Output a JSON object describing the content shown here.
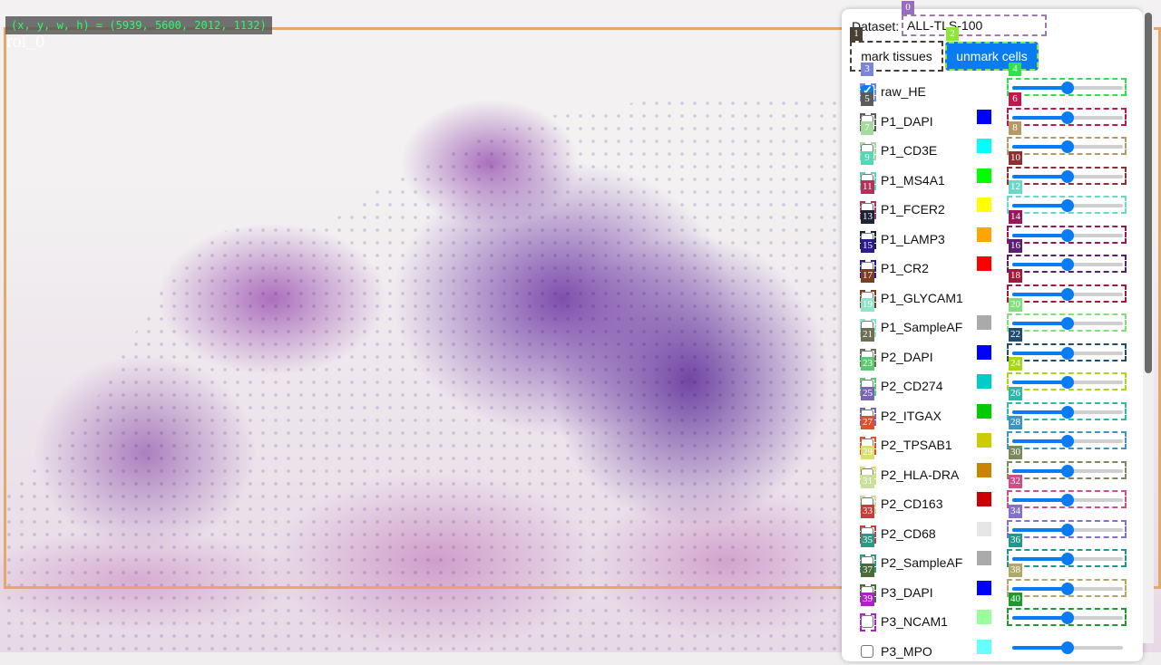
{
  "viewer": {
    "coords_text": "(x, y, w, h) = (5939, 5600, 2012, 1132)",
    "roi_label": "roi_0",
    "roi_color": "#e3a86a"
  },
  "panel": {
    "dataset_label": "Dataset:",
    "dataset_value": "ALL-TLS-100",
    "mark_tissues_label": "mark tissues",
    "unmark_cells_label": "unmark cells",
    "tags": {
      "dataset": "0",
      "mark": "1",
      "unmark": "2"
    }
  },
  "channels": [
    {
      "name": "raw_HE",
      "checked": true,
      "color": null,
      "cb_tag": "3",
      "cb_tag_color": "#7b86d9",
      "sl_tag": "4",
      "sl_tag_color": "#30e050",
      "level": 0.5
    },
    {
      "name": "P1_DAPI",
      "checked": false,
      "color": "#0000ff",
      "cb_tag": "5",
      "cb_tag_color": "#5b5b5b",
      "sl_tag": "6",
      "sl_tag_color": "#c0184b",
      "level": 0.5
    },
    {
      "name": "P1_CD3E",
      "checked": false,
      "color": "#00ffff",
      "cb_tag": "7",
      "cb_tag_color": "#a6d99c",
      "sl_tag": "8",
      "sl_tag_color": "#b49a66",
      "level": 0.5
    },
    {
      "name": "P1_MS4A1",
      "checked": false,
      "color": "#00ff00",
      "cb_tag": "9",
      "cb_tag_color": "#55d8b8",
      "sl_tag": "10",
      "sl_tag_color": "#8c3032",
      "level": 0.5
    },
    {
      "name": "P1_FCER2",
      "checked": false,
      "color": "#ffff00",
      "cb_tag": "11",
      "cb_tag_color": "#b3325a",
      "sl_tag": "12",
      "sl_tag_color": "#6ad8c8",
      "level": 0.5
    },
    {
      "name": "P1_LAMP3",
      "checked": false,
      "color": "#ffa500",
      "cb_tag": "13",
      "cb_tag_color": "#1b2436",
      "sl_tag": "14",
      "sl_tag_color": "#94185a",
      "level": 0.5
    },
    {
      "name": "P1_CR2",
      "checked": false,
      "color": "#ff0000",
      "cb_tag": "15",
      "cb_tag_color": "#2b1b8c",
      "sl_tag": "16",
      "sl_tag_color": "#5a1f6e",
      "level": 0.5
    },
    {
      "name": "P1_GLYCAM1",
      "checked": false,
      "color": "#ffffff",
      "cb_tag": "17",
      "cb_tag_color": "#7c3d25",
      "sl_tag": "18",
      "sl_tag_color": "#a01b3c",
      "level": 0.5
    },
    {
      "name": "P1_SampleAF",
      "checked": false,
      "color": "#aaaaaa",
      "cb_tag": "19",
      "cb_tag_color": "#8fe3c8",
      "sl_tag": "20",
      "sl_tag_color": "#7fe07c",
      "level": 0.5
    },
    {
      "name": "P2_DAPI",
      "checked": false,
      "color": "#0000ff",
      "cb_tag": "21",
      "cb_tag_color": "#6e6e55",
      "sl_tag": "22",
      "sl_tag_color": "#214e6e",
      "level": 0.5
    },
    {
      "name": "P2_CD274",
      "checked": false,
      "color": "#00cccc",
      "cb_tag": "23",
      "cb_tag_color": "#5ec86e",
      "sl_tag": "24",
      "sl_tag_color": "#a8d61a",
      "level": 0.5
    },
    {
      "name": "P2_ITGAX",
      "checked": false,
      "color": "#00cc00",
      "cb_tag": "25",
      "cb_tag_color": "#7a64b8",
      "sl_tag": "26",
      "sl_tag_color": "#2bb8a8",
      "level": 0.5
    },
    {
      "name": "P2_TPSAB1",
      "checked": false,
      "color": "#cccc00",
      "cb_tag": "27",
      "cb_tag_color": "#e0502a",
      "sl_tag": "28",
      "sl_tag_color": "#3d94c0",
      "level": 0.5
    },
    {
      "name": "P2_HLA-DRA",
      "checked": false,
      "color": "#cc8400",
      "cb_tag": "29",
      "cb_tag_color": "#d8e070",
      "sl_tag": "30",
      "sl_tag_color": "#7a8a5c",
      "level": 0.5
    },
    {
      "name": "P2_CD163",
      "checked": false,
      "color": "#cc0000",
      "cb_tag": "31",
      "cb_tag_color": "#c8e0a0",
      "sl_tag": "32",
      "sl_tag_color": "#cc4f88",
      "level": 0.5
    },
    {
      "name": "P2_CD68",
      "checked": false,
      "color": "#e6e6e6",
      "cb_tag": "33",
      "cb_tag_color": "#c83c3c",
      "sl_tag": "34",
      "sl_tag_color": "#8470c8",
      "level": 0.5
    },
    {
      "name": "P2_SampleAF",
      "checked": false,
      "color": "#aaaaaa",
      "cb_tag": "35",
      "cb_tag_color": "#2a9a84",
      "sl_tag": "36",
      "sl_tag_color": "#21968c",
      "level": 0.5
    },
    {
      "name": "P3_DAPI",
      "checked": false,
      "color": "#0000ff",
      "cb_tag": "37",
      "cb_tag_color": "#4b6a3c",
      "sl_tag": "38",
      "sl_tag_color": "#b0a868",
      "level": 0.5
    },
    {
      "name": "P3_NCAM1",
      "checked": false,
      "color": "#99ff99",
      "cb_tag": "39",
      "cb_tag_color": "#b020c8",
      "sl_tag": "40",
      "sl_tag_color": "#1e9a2e",
      "level": 0.5
    },
    {
      "name": "P3_MPO",
      "checked": false,
      "color": "#66ffff",
      "cb_tag": "",
      "cb_tag_color": "#ffffff",
      "sl_tag": "",
      "sl_tag_color": "#ffffff",
      "level": 0.5
    }
  ]
}
